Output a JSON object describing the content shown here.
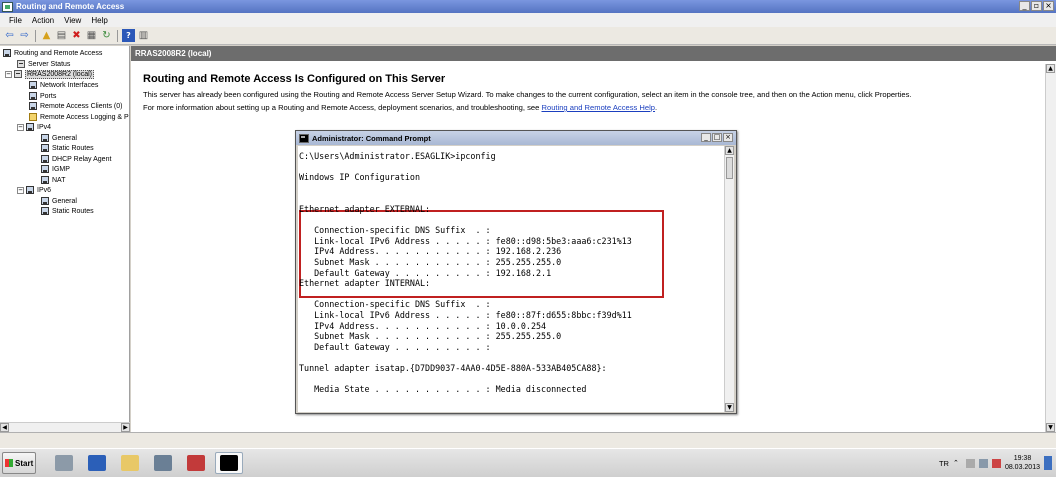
{
  "window": {
    "title": "Routing and Remote Access"
  },
  "menu": [
    "File",
    "Action",
    "View",
    "Help"
  ],
  "tree": {
    "root": "Routing and Remote Access",
    "server_status": "Server Status",
    "server": "RRAS2008R2 (local)",
    "items": {
      "network_interfaces": "Network Interfaces",
      "ports": "Ports",
      "remote_access_clients": "Remote Access Clients (0)",
      "remote_access_logging": "Remote Access Logging & P",
      "ipv4": "IPv4",
      "ipv4_general": "General",
      "ipv4_static_routes": "Static Routes",
      "dhcp_relay_agent": "DHCP Relay Agent",
      "igmp": "IGMP",
      "nat": "NAT",
      "ipv6": "IPv6",
      "ipv6_general": "General",
      "ipv6_static_routes": "Static Routes"
    }
  },
  "main": {
    "header": "RRAS2008R2 (local)",
    "title": "Routing and Remote Access Is Configured on This Server",
    "paragraph1": "This server has already been configured using the Routing and Remote Access Server Setup Wizard. To make changes to the current configuration, select an item in the console tree, and then on the Action menu, click Properties.",
    "paragraph2_prefix": "For more information about setting up a Routing and Remote Access, deployment scenarios, and troubleshooting, see ",
    "paragraph2_link": "Routing and Remote Access Help",
    "paragraph2_suffix": "."
  },
  "cmd": {
    "title": "Administrator: Command Prompt",
    "lines": [
      "C:\\Users\\Administrator.ESAGLIK>ipconfig",
      "",
      "Windows IP Configuration",
      "",
      "",
      "Ethernet adapter EXTERNAL:",
      "",
      "   Connection-specific DNS Suffix  . :",
      "   Link-local IPv6 Address . . . . . : fe80::d98:5be3:aaa6:c231%13",
      "   IPv4 Address. . . . . . . . . . . : 192.168.2.236",
      "   Subnet Mask . . . . . . . . . . . : 255.255.255.0",
      "   Default Gateway . . . . . . . . . : 192.168.2.1",
      "Ethernet adapter INTERNAL:",
      "",
      "   Connection-specific DNS Suffix  . :",
      "   Link-local IPv6 Address . . . . . : fe80::87f:d655:8bbc:f39d%11",
      "   IPv4 Address. . . . . . . . . . . : 10.0.0.254",
      "   Subnet Mask . . . . . . . . . . . : 255.255.255.0",
      "   Default Gateway . . . . . . . . . :",
      "",
      "Tunnel adapter isatap.{D7DD9037-4AA0-4D5E-880A-533AB405CA88}:",
      "",
      "   Media State . . . . . . . . . . . : Media disconnected"
    ]
  },
  "taskbar": {
    "start": "Start",
    "lang": "TR",
    "time": "19:38",
    "date": "08.03.2013"
  }
}
